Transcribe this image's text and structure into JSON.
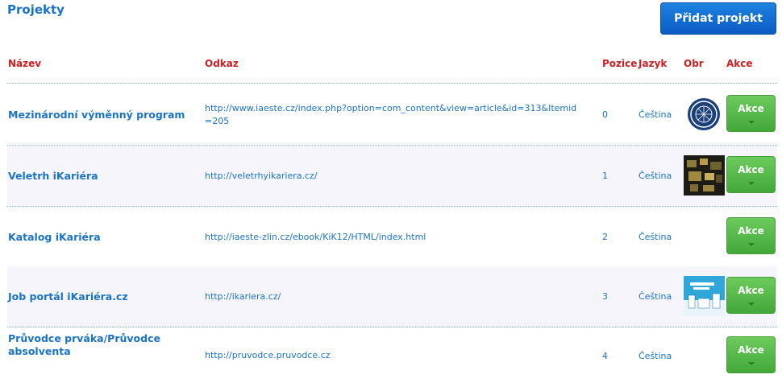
{
  "header": {
    "title": "Projekty",
    "add_button": "Přidat projekt"
  },
  "columns": {
    "name": "Název",
    "link": "Odkaz",
    "position": "Pozice",
    "language": "Jazyk",
    "image": "Obr",
    "actions": "Akce"
  },
  "rows": [
    {
      "name": "Mezinárodní výměnný program",
      "link": "http://www.iaeste.cz/index.php?option=com_content&view=article&id=313&Itemid=205",
      "position": "0",
      "language": "Čeština",
      "image": "iaeste-logo",
      "action_label": "Akce"
    },
    {
      "name": "Veletrh iKariéra",
      "link": "http://veletrhyikariera.cz/",
      "position": "1",
      "language": "Čeština",
      "image": "veletrh-photo",
      "action_label": "Akce"
    },
    {
      "name": "Katalog iKariéra",
      "link": "http://iaeste-zlin.cz/ebook/KiK12/HTML/index.html",
      "position": "2",
      "language": "Čeština",
      "image": "",
      "action_label": "Akce"
    },
    {
      "name": "Job portál iKariéra.cz",
      "link": "http://ikariera.cz/",
      "position": "3",
      "language": "Čeština",
      "image": "pruvodce-cover",
      "action_label": "Akce"
    },
    {
      "name": "Průvodce prváka/Průvodce absolventa",
      "link": "http://pruvodce.pruvodce.cz",
      "position": "4",
      "language": "Čeština",
      "image": "",
      "action_label": "Akce"
    }
  ],
  "colors": {
    "link": "#1a73c7",
    "header_red": "#cc1f1f",
    "primary_button": "#0b5cc4",
    "action_button": "#4fb144"
  }
}
